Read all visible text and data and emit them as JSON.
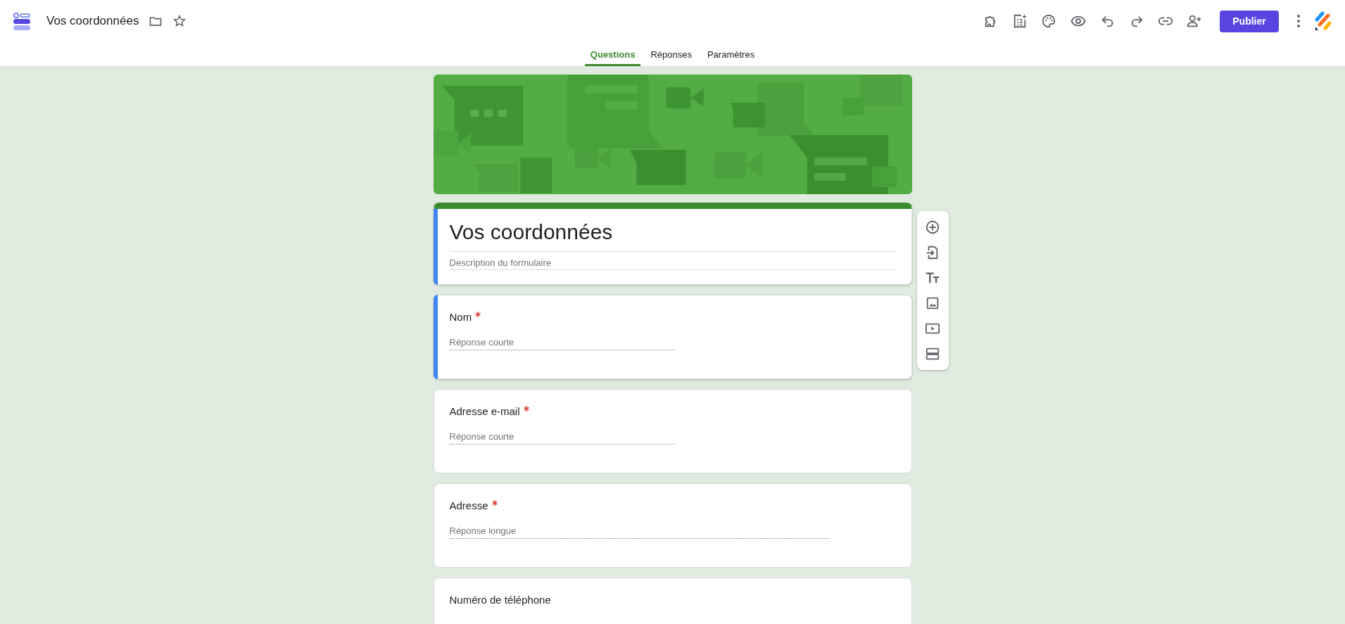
{
  "header": {
    "title": "Vos coordonnées",
    "publish_button": "Publier"
  },
  "tabs": [
    {
      "label": "Questions",
      "selected": true
    },
    {
      "label": "Réponses",
      "selected": false
    },
    {
      "label": "Paramètres",
      "selected": false
    }
  ],
  "form_header": {
    "title": "Vos coordonnées",
    "description_placeholder": "Description du formulaire",
    "selected": true
  },
  "questions": [
    {
      "title": "Nom",
      "required": true,
      "kind": "short",
      "placeholder": "Réponse courte",
      "selected": true
    },
    {
      "title": "Adresse e-mail",
      "required": true,
      "kind": "short",
      "placeholder": "Réponse courte",
      "selected": false
    },
    {
      "title": "Adresse",
      "required": true,
      "kind": "long",
      "placeholder": "Réponse longue",
      "selected": false
    },
    {
      "title": "Numéro de téléphone",
      "required": false,
      "selected": false
    }
  ]
}
